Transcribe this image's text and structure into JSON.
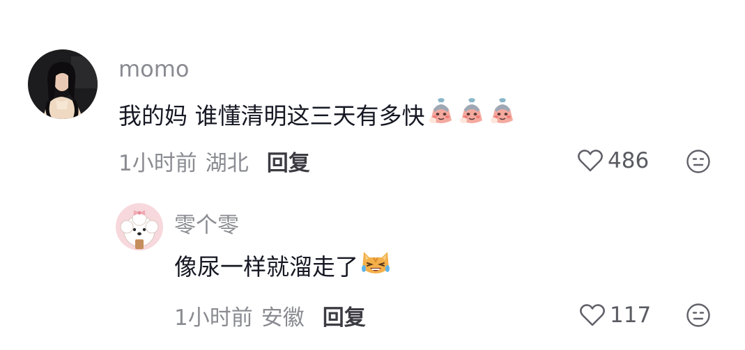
{
  "comments": [
    {
      "username": "momo",
      "text": "我的妈 谁懂清明这三天有多快",
      "emojis": [
        "bashful-onion-emoji",
        "bashful-onion-emoji",
        "bashful-onion-emoji"
      ],
      "time": "1小时前",
      "location": "湖北",
      "reply_label": "回复",
      "likes": "486",
      "avatar": "photo-of-woman-avatar"
    },
    {
      "username": "零个零",
      "text": "像尿一样就溜走了",
      "emojis": [
        "laughing-cat-emoji"
      ],
      "time": "1小时前",
      "location": "安徽",
      "reply_label": "回复",
      "likes": "117",
      "avatar": "fluffy-dog-avatar"
    }
  ],
  "icons": {
    "like": "heart-outline-icon",
    "dislike": "neutral-face-icon"
  },
  "colors": {
    "meta_gray": "#8a8b91",
    "text_dark": "#161823",
    "icon_gray": "#606168"
  }
}
